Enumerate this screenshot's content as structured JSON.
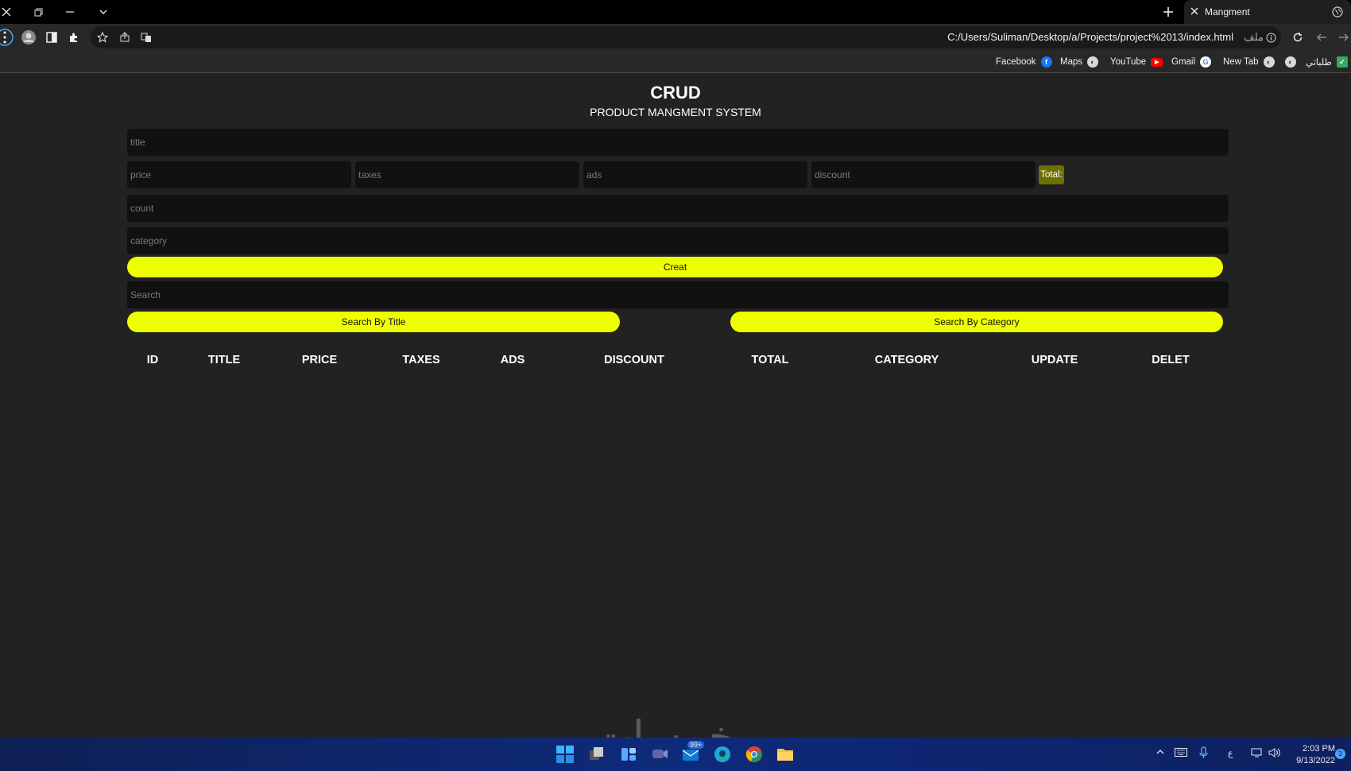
{
  "browser": {
    "tab_title": "Mangment",
    "address_url": "C:/Users/Suliman/Desktop/a/Projects/project%2013/index.html",
    "address_prefix": "ملف",
    "bookmarks": [
      "Facebook",
      "Maps",
      "YouTube",
      "Gmail",
      "New Tab",
      "طلباتي"
    ]
  },
  "app": {
    "title": "CRUD",
    "subtitle": "PRODUCT MANGMENT SYSTEM",
    "placeholders": {
      "title": "title",
      "price": "price",
      "taxes": "taxes",
      "ads": "ads",
      "discount": "discount",
      "count": "count",
      "category": "category",
      "search": "Search"
    },
    "total_label": "Total:",
    "create_button": "Creat",
    "search_title_button": "Search By Title",
    "search_category_button": "Search By Category",
    "table_headers": [
      "ID",
      "TITLE",
      "PRICE",
      "TAXES",
      "ADS",
      "DISCOUNT",
      "TOTAL",
      "CATEGORY",
      "UPDATE",
      "DELET"
    ],
    "accent_color": "#eeff00"
  },
  "taskbar": {
    "mail_badge": "99+",
    "time": "2:03 PM",
    "date": "9/13/2022",
    "lang": "ع",
    "notification_count": "3",
    "watermark": "خمسات"
  }
}
